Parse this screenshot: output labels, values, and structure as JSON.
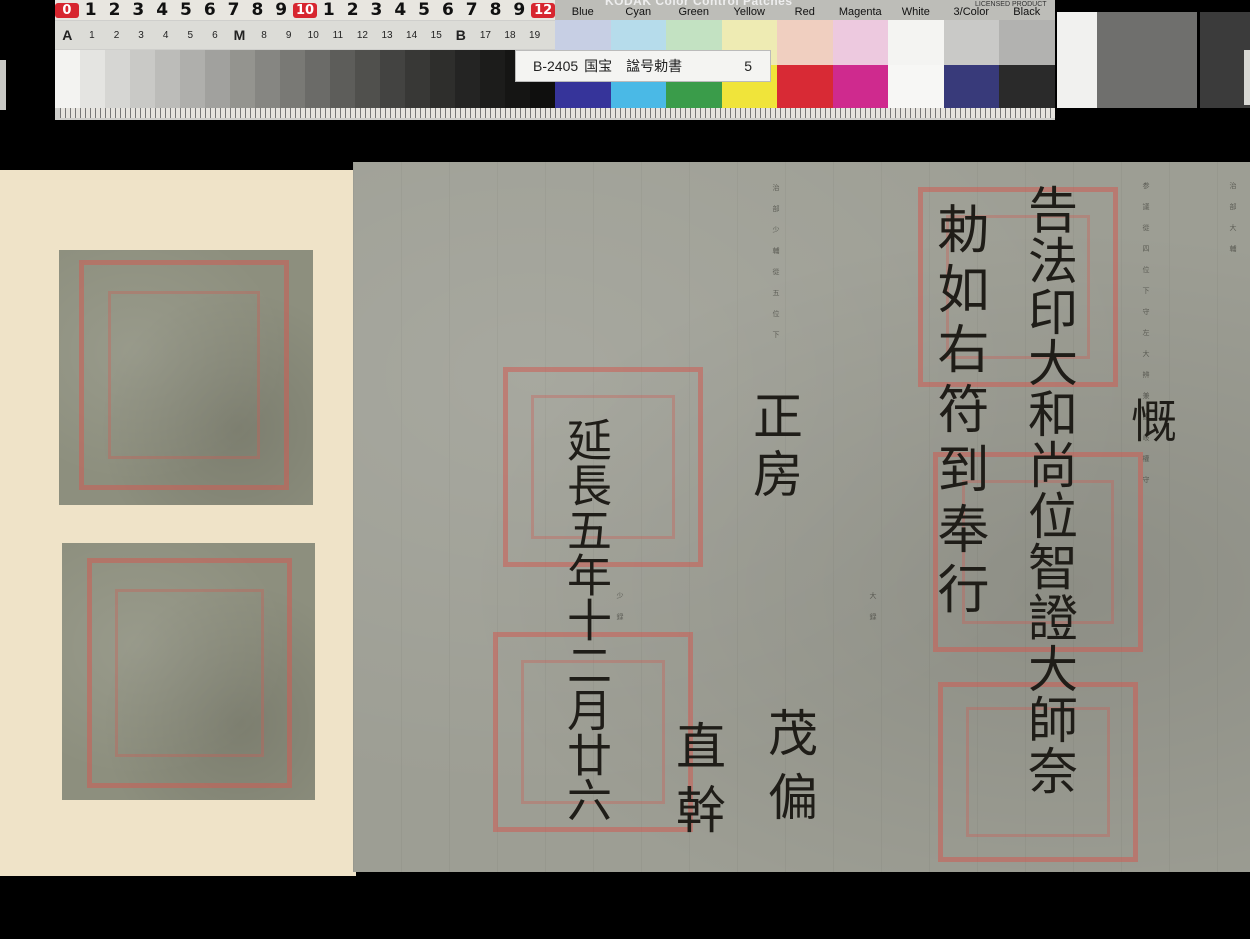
{
  "target": {
    "scale_top": [
      "0",
      "1",
      "2",
      "3",
      "4",
      "5",
      "6",
      "7",
      "8",
      "9",
      "10",
      "1",
      "2",
      "3",
      "4",
      "5",
      "6",
      "7",
      "8",
      "9",
      "12"
    ],
    "grey_labels": [
      "A",
      "1",
      "2",
      "3",
      "4",
      "5",
      "6",
      "M",
      "8",
      "9",
      "10",
      "11",
      "12",
      "13",
      "14",
      "15",
      "B",
      "17",
      "18",
      "19"
    ],
    "grey_steps": [
      "#f3f3f1",
      "#e4e4e1",
      "#d6d6d3",
      "#c9c9c6",
      "#bcbcb9",
      "#afafac",
      "#a1a19e",
      "#94948f",
      "#868682",
      "#797975",
      "#6b6b68",
      "#5d5d5a",
      "#50504d",
      "#434341",
      "#383836",
      "#2e2e2c",
      "#242423",
      "#1c1c1b",
      "#151514",
      "#0f0f0e"
    ],
    "patches_title": "KODAK Color Control Patches",
    "licence": "LICENSED PRODUCT",
    "patch_names": [
      "Blue",
      "Cyan",
      "Green",
      "Yellow",
      "Red",
      "Magenta",
      "White",
      "3/Color",
      "Black"
    ],
    "patch_light": [
      "#c7cfe4",
      "#b6dceb",
      "#c3e2c2",
      "#eeebb3",
      "#f0cfc0",
      "#edc9df",
      "#f4f4f2",
      "#c9c9c7",
      "#b2b2b0"
    ],
    "patch_dark": [
      "#36349a",
      "#4ab9e6",
      "#3a9c4a",
      "#f0e43a",
      "#d82a35",
      "#cf2a8e",
      "#f7f7f5",
      "#383a7a",
      "#2a2a2a"
    ],
    "id_code": "B-2405",
    "id_name": "国宝　諡号勅書",
    "id_page": "5"
  },
  "document": {
    "col_ki": "慨",
    "col_1": "告法印大和尚位智證大師奈",
    "col_2": "勅如右符到奉行",
    "col_3": "正房",
    "col_4": "茂偏",
    "col_5": "直幹",
    "col_6": "延長五年十二月廿六",
    "faint_1": "参議從四位下守左大辨兼讃岐權守",
    "faint_2": "治部少輔從五位下",
    "faint_3": "大録",
    "faint_4": "少録",
    "faint_5": "治部大輔"
  }
}
